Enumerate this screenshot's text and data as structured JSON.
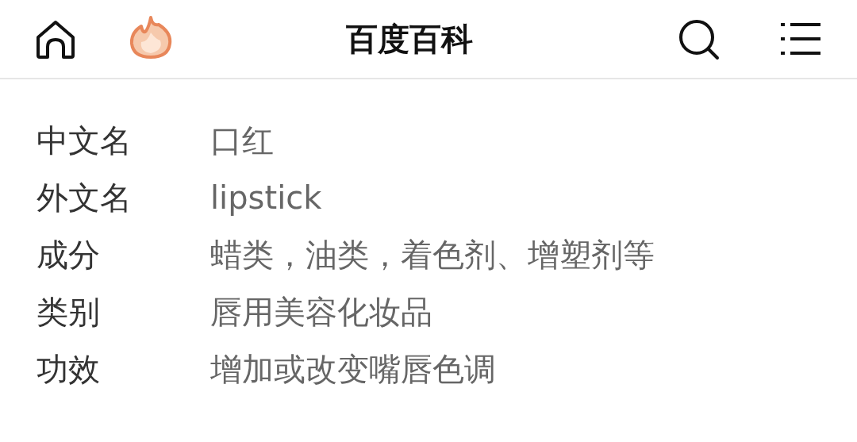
{
  "header": {
    "title": "百度百科"
  },
  "infobox": [
    {
      "label": "中文名",
      "value": "口红"
    },
    {
      "label": "外文名",
      "value": "lipstick"
    },
    {
      "label": "成分",
      "value": "蜡类，油类，着色剂、增塑剂等"
    },
    {
      "label": "类别",
      "value": "唇用美容化妆品"
    },
    {
      "label": "功效",
      "value": "增加或改变嘴唇色调"
    }
  ]
}
